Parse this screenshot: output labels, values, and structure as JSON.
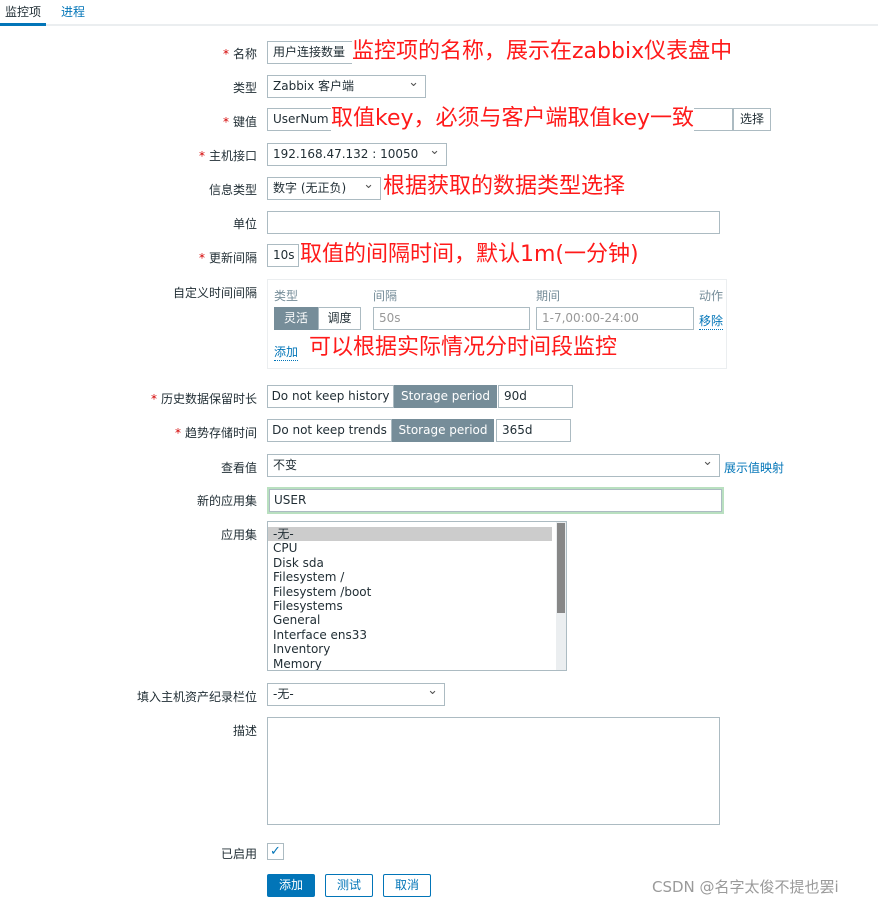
{
  "tabs": [
    {
      "label": "监控项"
    },
    {
      "label": "进程"
    }
  ],
  "form": {
    "name": {
      "label": "名称",
      "value": "用户连接数量",
      "annotation": "监控项的名称，展示在zabbix仪表盘中"
    },
    "type": {
      "label": "类型",
      "value": "Zabbix 客户端"
    },
    "key": {
      "label": "键值",
      "value": "UserNum",
      "select_button": "选择",
      "annotation": "取值key，必须与客户端取值key一致"
    },
    "interface": {
      "label": "主机接口",
      "value": "192.168.47.132 : 10050"
    },
    "info_type": {
      "label": "信息类型",
      "value": "数字 (无正负)",
      "annotation": "根据获取的数据类型选择"
    },
    "units": {
      "label": "单位",
      "value": ""
    },
    "update_interval": {
      "label": "更新间隔",
      "value": "10s",
      "annotation": "取值的间隔时间，默认1m(一分钟)"
    },
    "custom_intervals": {
      "label": "自定义时间间隔",
      "headers": [
        "类型",
        "间隔",
        "期间",
        "动作"
      ],
      "type_options": [
        "灵活",
        "调度"
      ],
      "interval_placeholder": "50s",
      "period_placeholder": "1-7,00:00-24:00",
      "remove": "移除",
      "add": "添加",
      "annotation": "可以根据实际情况分时间段监控"
    },
    "history": {
      "label": "历史数据保留时长",
      "options": [
        "Do not keep history",
        "Storage period"
      ],
      "value": "90d"
    },
    "trends": {
      "label": "趋势存储时间",
      "options": [
        "Do not keep trends",
        "Storage period"
      ],
      "value": "365d"
    },
    "show_value": {
      "label": "查看值",
      "value": "不变",
      "link": "展示值映射"
    },
    "new_app": {
      "label": "新的应用集",
      "value": "USER"
    },
    "applications": {
      "label": "应用集",
      "items": [
        "-无-",
        "CPU",
        "Disk sda",
        "Filesystem /",
        "Filesystem /boot",
        "Filesystems",
        "General",
        "Interface ens33",
        "Inventory",
        "Memory"
      ]
    },
    "inventory": {
      "label": "填入主机资产纪录栏位",
      "value": "-无-"
    },
    "description": {
      "label": "描述",
      "value": ""
    },
    "enabled": {
      "label": "已启用",
      "checked": true
    },
    "buttons": {
      "add": "添加",
      "test": "测试",
      "cancel": "取消"
    }
  },
  "watermark": "CSDN @名字太俊不提也罢i",
  "colors": {
    "accent": "#0275b8",
    "annotation": "#ff1a1a",
    "toggle_on": "#768d99"
  }
}
